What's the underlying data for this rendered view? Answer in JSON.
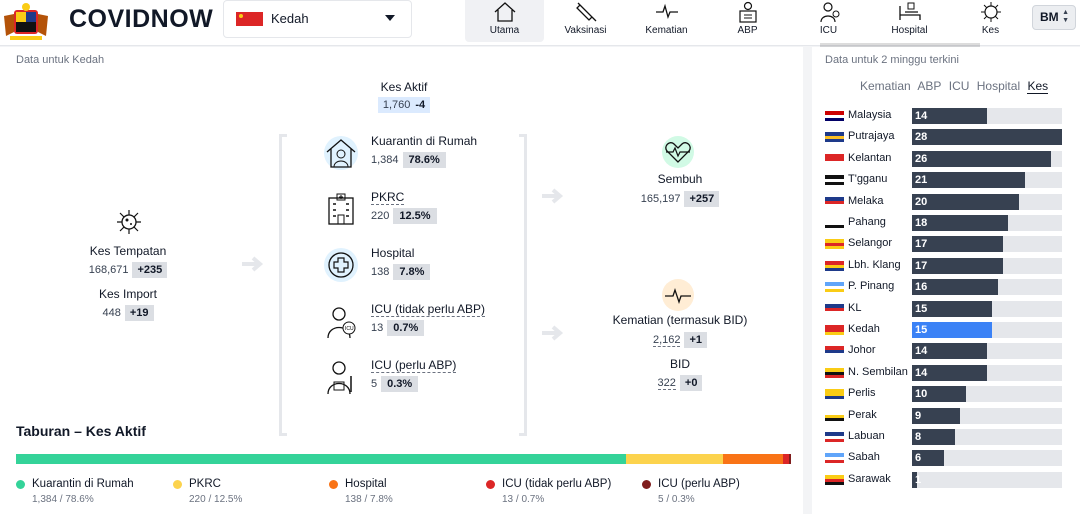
{
  "header": {
    "brand": "COVIDNOW",
    "state": "Kedah",
    "lang": "BM",
    "nav": [
      {
        "label": "Utama",
        "icon": "home-icon",
        "active": true
      },
      {
        "label": "Vaksinasi",
        "icon": "syringe-icon",
        "active": false
      },
      {
        "label": "Kematian",
        "icon": "heartbeat-line-icon",
        "active": false
      },
      {
        "label": "ABP",
        "icon": "ventilator-icon",
        "active": false
      },
      {
        "label": "ICU",
        "icon": "icu-doctor-icon",
        "active": false
      },
      {
        "label": "Hospital",
        "icon": "hospital-bed-icon",
        "active": false
      },
      {
        "label": "Kes",
        "icon": "virus-icon",
        "active": false
      }
    ]
  },
  "main": {
    "subtitle": "Data untuk Kedah",
    "active": {
      "label": "Kes Aktif",
      "value": "1,760",
      "delta": "-4"
    },
    "local": {
      "label": "Kes Tempatan",
      "value": "168,671",
      "delta": "+235"
    },
    "import": {
      "label": "Kes Import",
      "value": "448",
      "delta": "+19"
    },
    "categories": [
      {
        "label": "Kuarantin di Rumah",
        "value": "1,384",
        "pct": "78.6%",
        "icon": "home-quarantine-icon",
        "dotted": false
      },
      {
        "label": "PKRC",
        "value": "220",
        "pct": "12.5%",
        "icon": "building-icon",
        "dotted": true
      },
      {
        "label": "Hospital",
        "value": "138",
        "pct": "7.8%",
        "icon": "medical-cross-icon",
        "dotted": false
      },
      {
        "label": "ICU (tidak perlu ABP)",
        "value": "13",
        "pct": "0.7%",
        "icon": "icu-icon",
        "dotted": true
      },
      {
        "label": "ICU (perlu ABP)",
        "value": "5",
        "pct": "0.3%",
        "icon": "ventilator-patient-icon",
        "dotted": true
      }
    ],
    "recovered": {
      "label": "Sembuh",
      "value": "165,197",
      "delta": "+257"
    },
    "deaths": {
      "label": "Kematian (termasuk BID)",
      "value": "2,162",
      "delta": "+1"
    },
    "bid": {
      "label": "BID",
      "value": "322",
      "delta": "+0"
    },
    "distribution": {
      "title": "Taburan – Kes Aktif",
      "items": [
        {
          "label": "Kuarantin di Rumah",
          "value": "1,384 / 78.6%",
          "pct": 78.6,
          "color": "#34d399"
        },
        {
          "label": "PKRC",
          "value": "220 / 12.5%",
          "pct": 12.5,
          "color": "#fcd34d"
        },
        {
          "label": "Hospital",
          "value": "138 / 7.8%",
          "pct": 7.8,
          "color": "#f97316"
        },
        {
          "label": "ICU (tidak perlu ABP)",
          "value": "13 / 0.7%",
          "pct": 0.7,
          "color": "#dc2626"
        },
        {
          "label": "ICU (perlu ABP)",
          "value": "5 / 0.3%",
          "pct": 0.3,
          "color": "#7f1d1d"
        }
      ]
    }
  },
  "side": {
    "subtitle": "Data untuk 2 minggu terkini",
    "tabs": [
      "Kematian",
      "ABP",
      "ICU",
      "Hospital",
      "Kes"
    ],
    "active_tab": "Kes",
    "max": 28,
    "rows": [
      {
        "state": "Malaysia",
        "value": 14,
        "flag": [
          "#cc0000",
          "#ffffff",
          "#010066"
        ]
      },
      {
        "state": "Putrajaya",
        "value": 28,
        "flag": [
          "#1e3a8a",
          "#fbbf24",
          "#1e3a8a"
        ]
      },
      {
        "state": "Kelantan",
        "value": 26,
        "flag": [
          "#dc2626",
          "#dc2626",
          "#ffffff"
        ]
      },
      {
        "state": "T'gganu",
        "value": 21,
        "flag": [
          "#111111",
          "#ffffff",
          "#111111"
        ]
      },
      {
        "state": "Melaka",
        "value": 20,
        "flag": [
          "#1e3a8a",
          "#dc2626",
          "#ffffff"
        ]
      },
      {
        "state": "Pahang",
        "value": 18,
        "flag": [
          "#ffffff",
          "#ffffff",
          "#111111"
        ]
      },
      {
        "state": "Selangor",
        "value": 17,
        "flag": [
          "#facc15",
          "#dc2626",
          "#facc15"
        ]
      },
      {
        "state": "Lbh. Klang",
        "value": 17,
        "flag": [
          "#dc2626",
          "#facc15",
          "#1e3a8a"
        ]
      },
      {
        "state": "P. Pinang",
        "value": 16,
        "flag": [
          "#60a5fa",
          "#ffffff",
          "#facc15"
        ]
      },
      {
        "state": "KL",
        "value": 15,
        "flag": [
          "#1e3a8a",
          "#dc2626",
          "#ffffff"
        ]
      },
      {
        "state": "Kedah",
        "value": 15,
        "flag": [
          "#dc2626",
          "#dc2626",
          "#facc15"
        ],
        "highlight": true
      },
      {
        "state": "Johor",
        "value": 14,
        "flag": [
          "#dc2626",
          "#1e3a8a",
          "#ffffff"
        ]
      },
      {
        "state": "N. Sembilan",
        "value": 14,
        "flag": [
          "#facc15",
          "#111111",
          "#dc2626"
        ]
      },
      {
        "state": "Perlis",
        "value": 10,
        "flag": [
          "#facc15",
          "#facc15",
          "#1e3a8a"
        ]
      },
      {
        "state": "Perak",
        "value": 9,
        "flag": [
          "#ffffff",
          "#facc15",
          "#111111"
        ]
      },
      {
        "state": "Labuan",
        "value": 8,
        "flag": [
          "#1e3a8a",
          "#ffffff",
          "#dc2626"
        ]
      },
      {
        "state": "Sabah",
        "value": 6,
        "flag": [
          "#60a5fa",
          "#ffffff",
          "#dc2626"
        ]
      },
      {
        "state": "Sarawak",
        "value": 1,
        "flag": [
          "#facc15",
          "#dc2626",
          "#111111"
        ]
      }
    ]
  }
}
